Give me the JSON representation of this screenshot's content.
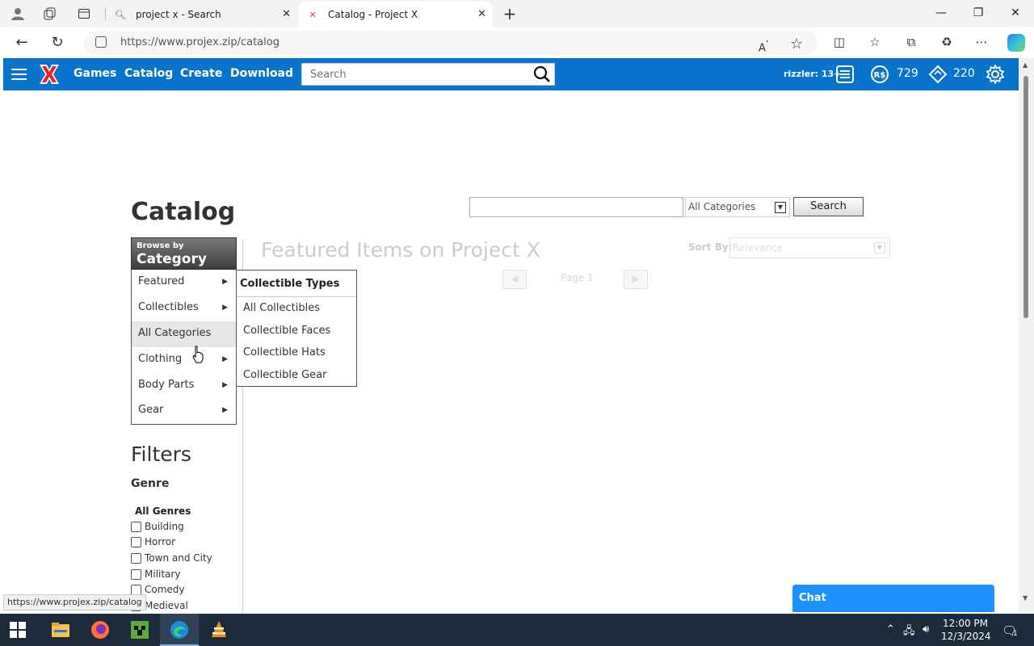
{
  "browser": {
    "tabs": [
      {
        "title": "project x - Search",
        "active": false
      },
      {
        "title": "Catalog - Project X",
        "active": true
      }
    ],
    "url": "https://www.projex.zip/catalog",
    "status_url": "https://www.projex.zip/catalog"
  },
  "header": {
    "nav": [
      "Games",
      "Catalog",
      "Create",
      "Download"
    ],
    "search_placeholder": "Search",
    "username": "rizzler: 13+",
    "robux": "729",
    "tickets": "220",
    "accent": "#0a73cc"
  },
  "catalog": {
    "title": "Catalog",
    "category_select": "All Categories",
    "search_button": "Search",
    "browse_small": "Browse by",
    "browse_big": "Category",
    "categories": [
      "Featured",
      "Collectibles",
      "All Categories",
      "Clothing",
      "Body Parts",
      "Gear"
    ],
    "submenu_title": "Collectible Types",
    "submenu_items": [
      "All Collectibles",
      "Collectible Faces",
      "Collectible Hats",
      "Collectible Gear"
    ],
    "featured_heading": "Featured Items on Project X",
    "sort_label": "Sort By:",
    "sort_value": "Relevance",
    "page_label": "Page 1",
    "filters_heading": "Filters",
    "genre_heading": "Genre",
    "all_genres": "All Genres",
    "genres": [
      "Building",
      "Horror",
      "Town and City",
      "Military",
      "Comedy",
      "Medieval"
    ]
  },
  "chat": {
    "label": "Chat"
  },
  "taskbar": {
    "time": "12:00 PM",
    "date": "12/3/2024",
    "notifications": "1"
  }
}
